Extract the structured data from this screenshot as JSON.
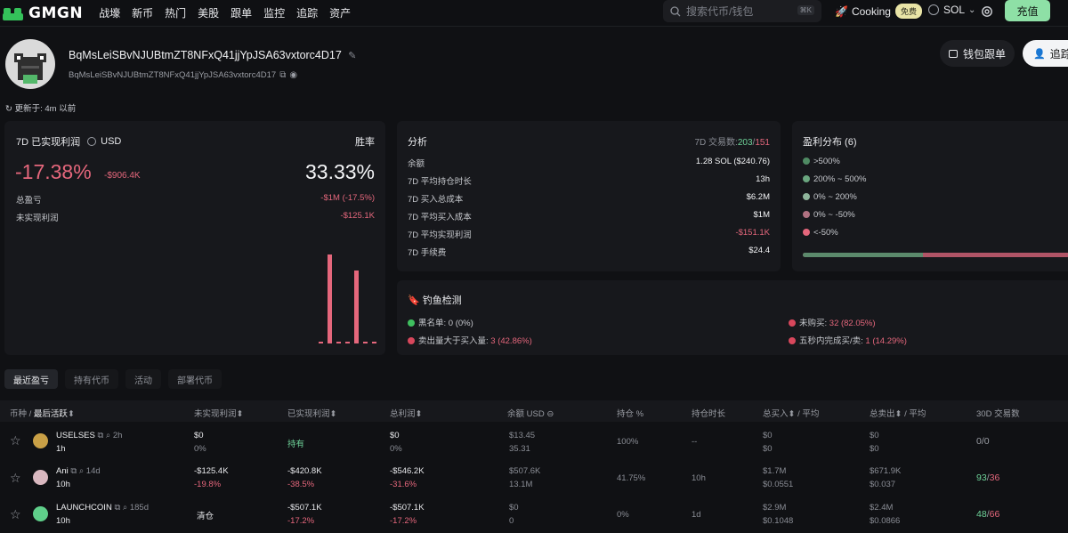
{
  "brand": {
    "name": "GMGN"
  },
  "nav": [
    "战壕",
    "新币",
    "热门",
    "美股",
    "跟单",
    "监控",
    "追踪",
    "资产"
  ],
  "search": {
    "placeholder": "搜索代币/钱包",
    "shortcut": "⌘K"
  },
  "cooking": {
    "label": "Cooking",
    "badge": "免费"
  },
  "chain": {
    "label": "SOL"
  },
  "recharge": "充值",
  "wallet": {
    "address": "BqMsLeiSBvNJUBtmZT8NFxQ41jjYpJSA63vxtorc4D17",
    "address_sub": "BqMsLeiSBvNJUBtmZT8NFxQ41jjYpJSA63vxtorc4D17",
    "copy_trade_label": "钱包跟单",
    "follow_label": "追踪",
    "updated": "更新于: 4m 以前"
  },
  "pnl_card": {
    "title": "7D 已实现利润",
    "currency": "USD",
    "win_rate_label": "胜率",
    "pnl_pct": "-17.38%",
    "pnl_usd": "-$906.4K",
    "win_rate": "33.33%",
    "total_label": "总盈亏",
    "total_value": "-$1M (-17.5%)",
    "unrealized_label": "未实现利润",
    "unrealized_value": "-$125.1K"
  },
  "analysis": {
    "title": "分析",
    "trades_label": "7D 交易数:",
    "trades_buy": "203",
    "trades_sep": "/",
    "trades_sell": "151",
    "rows": [
      {
        "label": "余额",
        "value": "1.28 SOL ($240.76)"
      },
      {
        "label": "7D 平均持仓时长",
        "value": "13h"
      },
      {
        "label": "7D 买入总成本",
        "value": "$6.2M"
      },
      {
        "label": "7D 平均买入成本",
        "value": "$1M"
      },
      {
        "label": "7D 平均实现利润",
        "value": "-$151.1K"
      },
      {
        "label": "7D 手续费",
        "value": "$24.4"
      }
    ]
  },
  "distribution": {
    "title": "盈利分布 (6)",
    "items": [
      {
        "label": ">500%",
        "color": "#4f8a63"
      },
      {
        "label": "200% ~ 500%",
        "color": "#6aa67f"
      },
      {
        "label": "0% ~ 200%",
        "color": "#8fb59c"
      },
      {
        "label": "0% ~ -50%",
        "color": "#b07181"
      },
      {
        "label": "<-50%",
        "color": "#e5677c"
      }
    ],
    "bar_green_fraction": 0.45
  },
  "phishing": {
    "title": "钓鱼检测",
    "blacklist_label": "黑名单:",
    "blacklist_value": "0 (0%)",
    "sell_gt_buy_label": "卖出量大于买入量:",
    "sell_gt_buy_value": "3 (42.86%)",
    "not_bought_label": "未购买:",
    "not_bought_value": "32 (82.05%)",
    "fast_trade_label": "五秒内完成买/卖:",
    "fast_trade_value": "1 (14.29%)"
  },
  "tabs": [
    "最近盈亏",
    "持有代币",
    "活动",
    "部署代币"
  ],
  "table": {
    "headers": {
      "token": "币种 / ",
      "last_active": "最后活跃",
      "unrealized": "未实现利润",
      "realized": "已实现利润",
      "total": "总利润",
      "balance": "余额",
      "balance_unit": "USD",
      "position": "持仓 %",
      "hold_time": "持仓时长",
      "total_buy": "总买入",
      "total_buy_avg": " / 平均",
      "total_sell": "总卖出",
      "total_sell_avg": " / 平均",
      "trades_30d": "30D 交易数"
    },
    "rows": [
      {
        "name": "USELSES",
        "age": "2h",
        "active": "1h",
        "unreal": "$0",
        "unreal_pct": "0%",
        "realized": "持有",
        "realized_pct": "",
        "total": "$0",
        "total_pct": "0%",
        "bal_usd": "$13.45",
        "bal_amt": "35.31",
        "position": "100%",
        "hold": "--",
        "buy": "$0",
        "buy_avg": "$0",
        "sell": "$0",
        "sell_avg": "$0",
        "trades_buy": "0",
        "trades_sell": "0"
      },
      {
        "name": "Ani",
        "age": "14d",
        "active": "10h",
        "unreal": "-$125.4K",
        "unreal_pct": "-19.8%",
        "realized": "-$420.8K",
        "realized_pct": "-38.5%",
        "total": "-$546.2K",
        "total_pct": "-31.6%",
        "bal_usd": "$507.6K",
        "bal_amt": "13.1M",
        "position": "41.75%",
        "hold": "10h",
        "buy": "$1.7M",
        "buy_avg": "$0.0551",
        "sell": "$671.9K",
        "sell_avg": "$0.037",
        "trades_buy": "93",
        "trades_sell": "36"
      },
      {
        "name": "LAUNCHCOIN",
        "age": "185d",
        "active": "10h",
        "unreal": "清仓",
        "unreal_pct": "",
        "realized": "-$507.1K",
        "realized_pct": "-17.2%",
        "total": "-$507.1K",
        "total_pct": "-17.2%",
        "bal_usd": "$0",
        "bal_amt": "0",
        "position": "0%",
        "hold": "1d",
        "buy": "$2.9M",
        "buy_avg": "$0.1048",
        "sell": "$2.4M",
        "sell_avg": "$0.0866",
        "trades_buy": "48",
        "trades_sell": "66"
      }
    ]
  },
  "chart_data": {
    "type": "bar",
    "categories": [
      "1",
      "2",
      "3",
      "4",
      "5",
      "6",
      "7"
    ],
    "values": [
      0,
      93,
      0,
      0,
      76,
      0,
      0
    ],
    "ylim": [
      0,
      100
    ]
  }
}
